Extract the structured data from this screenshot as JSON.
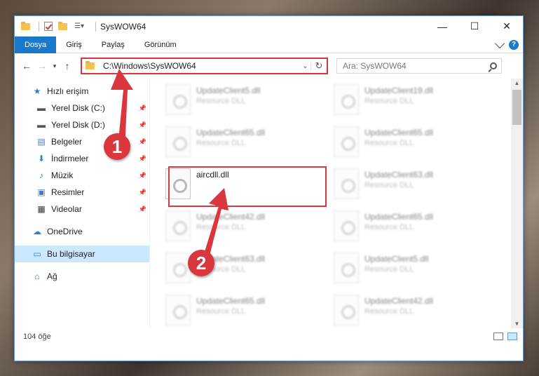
{
  "window": {
    "title": "SysWOW64",
    "controls": {
      "minimize": "—",
      "maximize": "☐",
      "close": "✕"
    }
  },
  "ribbon": {
    "tabs": [
      "Dosya",
      "Giriş",
      "Paylaş",
      "Görünüm"
    ],
    "help": "?"
  },
  "address": {
    "path": "C:\\Windows\\SysWOW64",
    "search_placeholder": "Ara: SysWOW64"
  },
  "sidebar": {
    "quick_access": "Hızlı erişim",
    "pinned": [
      {
        "label": "Yerel Disk (C:)",
        "icon": "drive-icon"
      },
      {
        "label": "Yerel Disk (D:)",
        "icon": "drive-icon"
      },
      {
        "label": "Belgeler",
        "icon": "documents-icon"
      },
      {
        "label": "İndirmeler",
        "icon": "download-icon"
      },
      {
        "label": "Müzik",
        "icon": "music-icon"
      },
      {
        "label": "Resimler",
        "icon": "pictures-icon"
      },
      {
        "label": "Videolar",
        "icon": "videos-icon"
      }
    ],
    "onedrive": "OneDrive",
    "this_pc": "Bu bilgisayar",
    "network": "Ağ"
  },
  "files": {
    "left_column": [
      {
        "name": "UpdateClient5.dll",
        "desc": "Resource DLL"
      },
      {
        "name": "UpdateClient65.dll",
        "desc": "Resource DLL"
      },
      {
        "name": "aircdll.dll",
        "desc": ""
      },
      {
        "name": "UpdateClient42.dll",
        "desc": "Resource DLL"
      },
      {
        "name": "UpdateClient63.dll",
        "desc": "Resource DLL"
      },
      {
        "name": "UpdateClient65.dll",
        "desc": "Resource DLL"
      }
    ],
    "right_column": [
      {
        "name": "UpdateClient19.dll",
        "desc": "Resource DLL"
      },
      {
        "name": "UpdateClient65.dll",
        "desc": "Resource DLL"
      },
      {
        "name": "UpdateClient63.dll",
        "desc": "Resource DLL"
      },
      {
        "name": "UpdateClient65.dll",
        "desc": "Resource DLL"
      },
      {
        "name": "UpdateClient5.dll",
        "desc": "Resource DLL"
      },
      {
        "name": "UpdateClient42.dll",
        "desc": "Resource DLL"
      }
    ]
  },
  "status": {
    "count": "104 öğe"
  },
  "callouts": {
    "one": "1",
    "two": "2"
  },
  "colors": {
    "accent": "#1979ca",
    "highlight": "#d9363e",
    "selected": "#cce8ff"
  }
}
